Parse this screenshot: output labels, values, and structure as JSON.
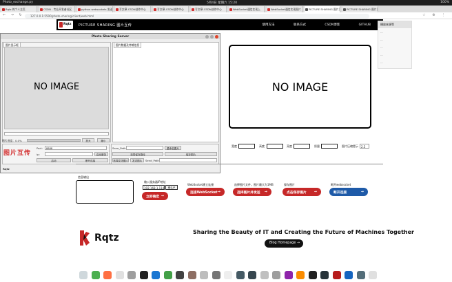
{
  "os": {
    "app_name": "Photo_exchange.py",
    "clock": "5月4日 星期六 15:20",
    "tray": "100%"
  },
  "browser": {
    "tabs": [
      {
        "label": "Rqtz 的个人主页",
        "color": "#c62828"
      },
      {
        "label": "CSDN - 专业开发者社区",
        "color": "#d32f2f"
      },
      {
        "label": "python websockets 发送",
        "color": "#d32f2f"
      },
      {
        "label": "写文章-CSDN创作中心",
        "color": "#d32f2f"
      },
      {
        "label": "写文章-CSDN创作中心",
        "color": "#d32f2f"
      },
      {
        "label": "写文章-CSDN创作中心",
        "color": "#d32f2f"
      },
      {
        "label": "WebSocket通信实现上",
        "color": "#d32f2f"
      },
      {
        "label": "WebSocket通信实现图片",
        "color": "#d32f2f"
      },
      {
        "label": "PICTURE SHARING 图片互传",
        "color": "#555555"
      },
      {
        "label": "PICTURE SHARING 图片互传",
        "color": "#555555"
      }
    ],
    "url": "127.0.0.1:5500/photo-sharing/client/web.html",
    "nav_glyphs": "← → ↻",
    "ext_glyphs": "☆ ⊕ ⋮"
  },
  "site": {
    "logo_text": "Rqtz",
    "title": "PICTURE SHARING 图片互传",
    "nav": [
      "使用方法",
      "联系方式",
      "CSDN博客",
      "GITHUB"
    ]
  },
  "dropdown": {
    "head": "播放来源等",
    "items": [
      "...",
      "...",
      "...",
      "...",
      "..."
    ]
  },
  "gui": {
    "title": "Photo Sharing Server",
    "left_tab": "图片显示框",
    "right_tab": "图片数据及传输信息",
    "no_image": "NO IMAGE",
    "progress_label": "图片进度：",
    "progress_value": "0.0%",
    "progress_fraction": 0.0,
    "btn_enlarge": "放大",
    "btn_shrink": "缩小",
    "brand": "图片互传",
    "port_label": "Port:",
    "port_value": "8888",
    "ip_label": "ip:",
    "ip_value": "",
    "btn_start_server": "启动服务",
    "btn_start": "启动",
    "btn_disconnect": "断开连接",
    "save_path_label": "Save_Path:",
    "btn_rename": "重命名图片",
    "btn_choose_path": "选择保存路径",
    "btn_save": "保存图片",
    "btn_choose_send": "选择发送图片",
    "btn_send": "发送图片",
    "send_path_label": "Send_Path:",
    "footer": "Rqtz"
  },
  "preview": {
    "no_image": "NO IMAGE"
  },
  "params": [
    {
      "label": "宽度"
    },
    {
      "label": "高度"
    },
    {
      "label": "亮度"
    },
    {
      "label": "质量"
    }
  ],
  "compress_label": "图片压缩提示",
  "compress_value": "2.5",
  "controls": {
    "log_label": "信息输出",
    "ip_label": "输入服务器IP地址",
    "ip_value": "192.168.1.114",
    "ip_confirm": "确认IP",
    "connect": "立即确定",
    "ws_label": "WebSocket建立连接",
    "ws_btn": "连接WebSocket",
    "send_label": "选择图片文件，图片最大为1MB",
    "send_btn": "选择图片并发送",
    "save_label": "保存图片",
    "save_btn": "点击保存图片",
    "disconnect_label": "断开websocket",
    "disconnect_btn": "断开连接"
  },
  "footer": {
    "logo_word": "Rqtz",
    "tagline": "Sharing the Beauty of IT and Creating the Future of Machines Together",
    "blog_btn": "Blog Homepage"
  },
  "colors": {
    "red": "#c62828",
    "blue": "#1e5aa8",
    "black": "#000000"
  },
  "dock": [
    {
      "name": "trash-icon",
      "color": "#cfd8dc"
    },
    {
      "name": "chrome-icon",
      "color": "#4caf50"
    },
    {
      "name": "firefox-icon",
      "color": "#ff7043"
    },
    {
      "name": "files-icon",
      "color": "#e0e0e0"
    },
    {
      "name": "settings-icon",
      "color": "#9e9e9e"
    },
    {
      "name": "qq-icon",
      "color": "#212121"
    },
    {
      "name": "vscode-icon",
      "color": "#1976d2"
    },
    {
      "name": "wechat-icon",
      "color": "#43a047"
    },
    {
      "name": "terminal-icon",
      "color": "#424242"
    },
    {
      "name": "gimp-icon",
      "color": "#8d6e63"
    },
    {
      "name": "box-icon",
      "color": "#bdbdbd"
    },
    {
      "name": "toolbox-icon",
      "color": "#757575"
    },
    {
      "name": "text-editor-icon",
      "color": "#eeeeee"
    },
    {
      "name": "video-icon",
      "color": "#455a64"
    },
    {
      "name": "plane-icon",
      "color": "#37474f"
    },
    {
      "name": "archive-icon",
      "color": "#c0c0c0"
    },
    {
      "name": "calculator-icon",
      "color": "#9e9e9e"
    },
    {
      "name": "media-icon",
      "color": "#8e24aa"
    },
    {
      "name": "firefox2-icon",
      "color": "#fb8c00"
    },
    {
      "name": "app-icon",
      "color": "#212121"
    },
    {
      "name": "monitor-icon",
      "color": "#263238"
    },
    {
      "name": "network-icon",
      "color": "#b71c1c"
    },
    {
      "name": "paint-icon",
      "color": "#1565c0"
    },
    {
      "name": "screenshot-icon",
      "color": "#546e7a"
    },
    {
      "name": "trash2-icon",
      "color": "#e0e0e0"
    }
  ]
}
